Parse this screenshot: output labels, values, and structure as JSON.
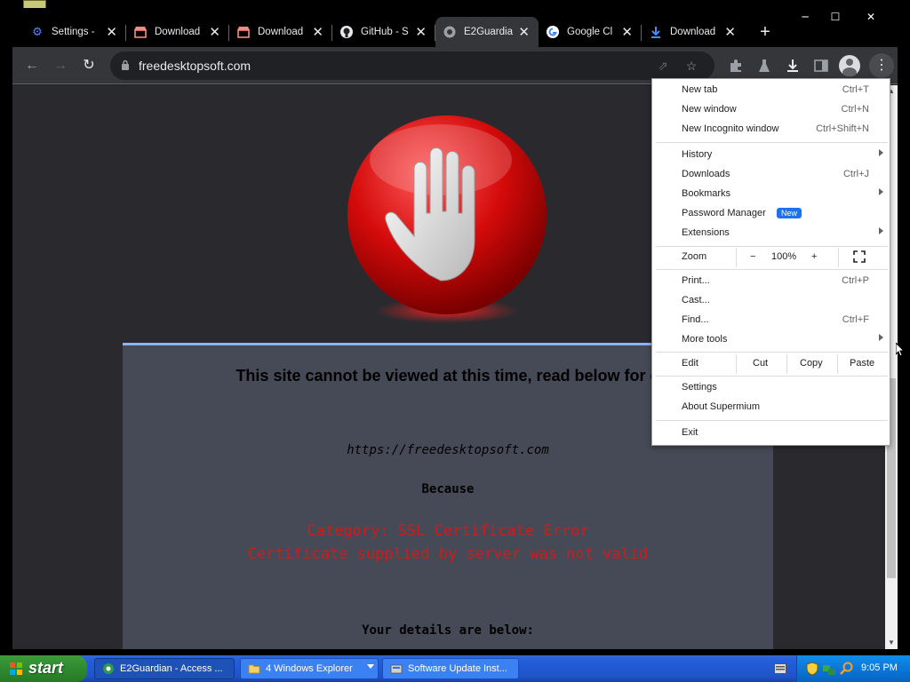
{
  "window": {
    "controls": {
      "minimize": "─",
      "maximize": "☐",
      "close": "✕"
    }
  },
  "tabs": [
    {
      "title": "Settings - ",
      "icon": "gear-icon",
      "active": false
    },
    {
      "title": "Download",
      "icon": "store-icon",
      "active": false
    },
    {
      "title": "Download",
      "icon": "store-icon",
      "active": false
    },
    {
      "title": "GitHub - S",
      "icon": "github-icon",
      "active": false
    },
    {
      "title": "E2Guardia",
      "icon": "globe-icon",
      "active": true
    },
    {
      "title": "Google Cl",
      "icon": "google-icon",
      "active": false
    },
    {
      "title": "Download",
      "icon": "download-icon",
      "active": false
    }
  ],
  "toolbar": {
    "url": "freedesktopsoft.com"
  },
  "page": {
    "headline": "This site cannot be viewed at this time, read below for d",
    "blocked_url": "https://freedesktopsoft.com",
    "because": "Because",
    "category_line1": "Category: SSL Certificate Error",
    "category_line2": "Certificate supplied by server was not valid",
    "details": "Your details are below:"
  },
  "menu": {
    "new_tab": {
      "label": "New tab",
      "shortcut": "Ctrl+T"
    },
    "new_window": {
      "label": "New window",
      "shortcut": "Ctrl+N"
    },
    "new_incognito": {
      "label": "New Incognito window",
      "shortcut": "Ctrl+Shift+N"
    },
    "history": {
      "label": "History"
    },
    "downloads": {
      "label": "Downloads",
      "shortcut": "Ctrl+J"
    },
    "bookmarks": {
      "label": "Bookmarks"
    },
    "password_manager": {
      "label": "Password Manager",
      "badge": "New"
    },
    "extensions": {
      "label": "Extensions"
    },
    "zoom": {
      "label": "Zoom",
      "minus": "−",
      "value": "100%",
      "plus": "+"
    },
    "print": {
      "label": "Print...",
      "shortcut": "Ctrl+P"
    },
    "cast": {
      "label": "Cast..."
    },
    "find": {
      "label": "Find...",
      "shortcut": "Ctrl+F"
    },
    "more_tools": {
      "label": "More tools"
    },
    "edit": {
      "label": "Edit",
      "cut": "Cut",
      "copy": "Copy",
      "paste": "Paste"
    },
    "settings": {
      "label": "Settings"
    },
    "about": {
      "label": "About Supermium"
    },
    "exit": {
      "label": "Exit"
    }
  },
  "taskbar": {
    "start": "start",
    "tasks": [
      {
        "label": "E2Guardian - Access ...",
        "icon": "browser-icon"
      },
      {
        "label": "4 Windows Explorer",
        "icon": "folder-icon"
      },
      {
        "label": "Software Update Inst...",
        "icon": "installer-icon"
      }
    ],
    "clock": "9:05 PM"
  },
  "colors": {
    "accent": "#8ab4f8",
    "error_red": "#d11a1a",
    "new_badge": "#1a73e8"
  }
}
